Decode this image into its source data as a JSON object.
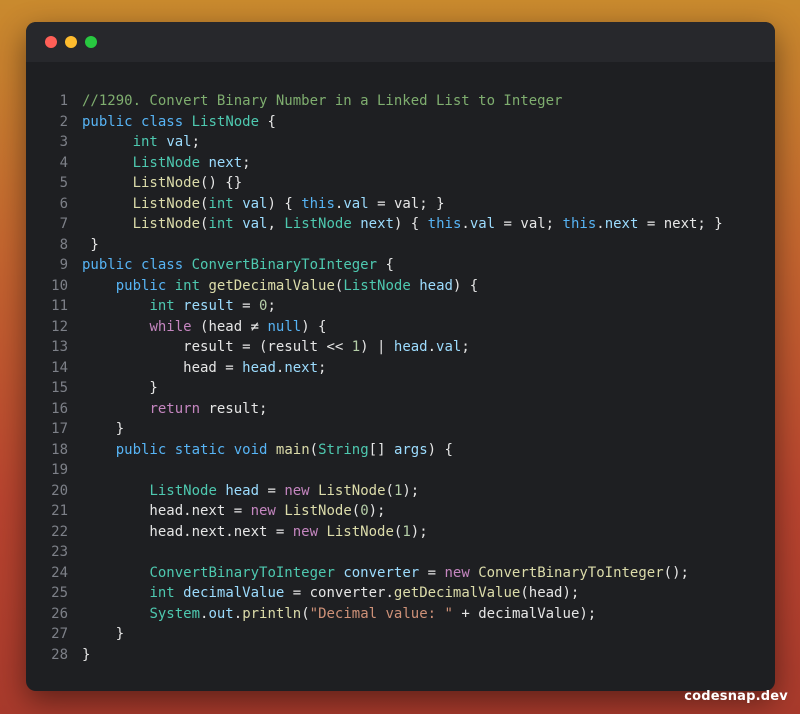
{
  "window": {
    "buttons": [
      {
        "name": "close",
        "color": "#ff5f57"
      },
      {
        "name": "minimize",
        "color": "#febc2e"
      },
      {
        "name": "maximize",
        "color": "#28c840"
      }
    ]
  },
  "code": {
    "language": "java",
    "lines": [
      {
        "n": "1",
        "tokens": [
          {
            "t": "//1290. Convert Binary Number in a Linked List to Integer",
            "c": "comment"
          }
        ]
      },
      {
        "n": "2",
        "tokens": [
          {
            "t": "public",
            "c": "kw2"
          },
          {
            "t": " ",
            "c": "plain"
          },
          {
            "t": "class",
            "c": "kw2"
          },
          {
            "t": " ",
            "c": "plain"
          },
          {
            "t": "ListNode",
            "c": "type"
          },
          {
            "t": " {",
            "c": "plain"
          }
        ]
      },
      {
        "n": "3",
        "tokens": [
          {
            "t": "      ",
            "c": "plain"
          },
          {
            "t": "int",
            "c": "type"
          },
          {
            "t": " ",
            "c": "plain"
          },
          {
            "t": "val",
            "c": "var"
          },
          {
            "t": ";",
            "c": "plain"
          }
        ]
      },
      {
        "n": "4",
        "tokens": [
          {
            "t": "      ",
            "c": "plain"
          },
          {
            "t": "ListNode",
            "c": "type"
          },
          {
            "t": " ",
            "c": "plain"
          },
          {
            "t": "next",
            "c": "var"
          },
          {
            "t": ";",
            "c": "plain"
          }
        ]
      },
      {
        "n": "5",
        "tokens": [
          {
            "t": "      ",
            "c": "plain"
          },
          {
            "t": "ListNode",
            "c": "fn"
          },
          {
            "t": "() {}",
            "c": "plain"
          }
        ]
      },
      {
        "n": "6",
        "tokens": [
          {
            "t": "      ",
            "c": "plain"
          },
          {
            "t": "ListNode",
            "c": "fn"
          },
          {
            "t": "(",
            "c": "plain"
          },
          {
            "t": "int",
            "c": "type"
          },
          {
            "t": " ",
            "c": "plain"
          },
          {
            "t": "val",
            "c": "var"
          },
          {
            "t": ") { ",
            "c": "plain"
          },
          {
            "t": "this",
            "c": "kw2"
          },
          {
            "t": ".",
            "c": "plain"
          },
          {
            "t": "val",
            "c": "var"
          },
          {
            "t": " = val; }",
            "c": "plain"
          }
        ]
      },
      {
        "n": "7",
        "tokens": [
          {
            "t": "      ",
            "c": "plain"
          },
          {
            "t": "ListNode",
            "c": "fn"
          },
          {
            "t": "(",
            "c": "plain"
          },
          {
            "t": "int",
            "c": "type"
          },
          {
            "t": " ",
            "c": "plain"
          },
          {
            "t": "val",
            "c": "var"
          },
          {
            "t": ", ",
            "c": "plain"
          },
          {
            "t": "ListNode",
            "c": "type"
          },
          {
            "t": " ",
            "c": "plain"
          },
          {
            "t": "next",
            "c": "var"
          },
          {
            "t": ") { ",
            "c": "plain"
          },
          {
            "t": "this",
            "c": "kw2"
          },
          {
            "t": ".",
            "c": "plain"
          },
          {
            "t": "val",
            "c": "var"
          },
          {
            "t": " = val; ",
            "c": "plain"
          },
          {
            "t": "this",
            "c": "kw2"
          },
          {
            "t": ".",
            "c": "plain"
          },
          {
            "t": "next",
            "c": "var"
          },
          {
            "t": " = next; }",
            "c": "plain"
          }
        ]
      },
      {
        "n": "8",
        "tokens": [
          {
            "t": " }",
            "c": "plain"
          }
        ]
      },
      {
        "n": "9",
        "tokens": [
          {
            "t": "public",
            "c": "kw2"
          },
          {
            "t": " ",
            "c": "plain"
          },
          {
            "t": "class",
            "c": "kw2"
          },
          {
            "t": " ",
            "c": "plain"
          },
          {
            "t": "ConvertBinaryToInteger",
            "c": "type"
          },
          {
            "t": " {",
            "c": "plain"
          }
        ]
      },
      {
        "n": "10",
        "tokens": [
          {
            "t": "    ",
            "c": "plain"
          },
          {
            "t": "public",
            "c": "kw2"
          },
          {
            "t": " ",
            "c": "plain"
          },
          {
            "t": "int",
            "c": "type"
          },
          {
            "t": " ",
            "c": "plain"
          },
          {
            "t": "getDecimalValue",
            "c": "fn"
          },
          {
            "t": "(",
            "c": "plain"
          },
          {
            "t": "ListNode",
            "c": "type"
          },
          {
            "t": " ",
            "c": "plain"
          },
          {
            "t": "head",
            "c": "var"
          },
          {
            "t": ") {",
            "c": "plain"
          }
        ]
      },
      {
        "n": "11",
        "tokens": [
          {
            "t": "        ",
            "c": "plain"
          },
          {
            "t": "int",
            "c": "type"
          },
          {
            "t": " ",
            "c": "plain"
          },
          {
            "t": "result",
            "c": "var"
          },
          {
            "t": " = ",
            "c": "plain"
          },
          {
            "t": "0",
            "c": "num"
          },
          {
            "t": ";",
            "c": "plain"
          }
        ]
      },
      {
        "n": "12",
        "tokens": [
          {
            "t": "        ",
            "c": "plain"
          },
          {
            "t": "while",
            "c": "kw"
          },
          {
            "t": " (head ",
            "c": "plain"
          },
          {
            "t": "≠",
            "c": "plain"
          },
          {
            "t": " ",
            "c": "plain"
          },
          {
            "t": "null",
            "c": "kw2"
          },
          {
            "t": ") {",
            "c": "plain"
          }
        ]
      },
      {
        "n": "13",
        "tokens": [
          {
            "t": "            result = (result ",
            "c": "plain"
          },
          {
            "t": "<<",
            "c": "plain"
          },
          {
            "t": " ",
            "c": "plain"
          },
          {
            "t": "1",
            "c": "num"
          },
          {
            "t": ") | ",
            "c": "plain"
          },
          {
            "t": "head",
            "c": "var"
          },
          {
            "t": ".",
            "c": "plain"
          },
          {
            "t": "val",
            "c": "var"
          },
          {
            "t": ";",
            "c": "plain"
          }
        ]
      },
      {
        "n": "14",
        "tokens": [
          {
            "t": "            head = ",
            "c": "plain"
          },
          {
            "t": "head",
            "c": "var"
          },
          {
            "t": ".",
            "c": "plain"
          },
          {
            "t": "next",
            "c": "var"
          },
          {
            "t": ";",
            "c": "plain"
          }
        ]
      },
      {
        "n": "15",
        "tokens": [
          {
            "t": "        }",
            "c": "plain"
          }
        ]
      },
      {
        "n": "16",
        "tokens": [
          {
            "t": "        ",
            "c": "plain"
          },
          {
            "t": "return",
            "c": "kw"
          },
          {
            "t": " result;",
            "c": "plain"
          }
        ]
      },
      {
        "n": "17",
        "tokens": [
          {
            "t": "    }",
            "c": "plain"
          }
        ]
      },
      {
        "n": "18",
        "tokens": [
          {
            "t": "    ",
            "c": "plain"
          },
          {
            "t": "public",
            "c": "kw2"
          },
          {
            "t": " ",
            "c": "plain"
          },
          {
            "t": "static",
            "c": "kw2"
          },
          {
            "t": " ",
            "c": "plain"
          },
          {
            "t": "void",
            "c": "kw2"
          },
          {
            "t": " ",
            "c": "plain"
          },
          {
            "t": "main",
            "c": "fn"
          },
          {
            "t": "(",
            "c": "plain"
          },
          {
            "t": "String",
            "c": "type"
          },
          {
            "t": "[] ",
            "c": "plain"
          },
          {
            "t": "args",
            "c": "var"
          },
          {
            "t": ") {",
            "c": "plain"
          }
        ]
      },
      {
        "n": "19",
        "tokens": []
      },
      {
        "n": "20",
        "tokens": [
          {
            "t": "        ",
            "c": "plain"
          },
          {
            "t": "ListNode",
            "c": "type"
          },
          {
            "t": " ",
            "c": "plain"
          },
          {
            "t": "head",
            "c": "var"
          },
          {
            "t": " = ",
            "c": "plain"
          },
          {
            "t": "new",
            "c": "kw"
          },
          {
            "t": " ",
            "c": "plain"
          },
          {
            "t": "ListNode",
            "c": "fn"
          },
          {
            "t": "(",
            "c": "plain"
          },
          {
            "t": "1",
            "c": "num"
          },
          {
            "t": ");",
            "c": "plain"
          }
        ]
      },
      {
        "n": "21",
        "tokens": [
          {
            "t": "        head.next = ",
            "c": "plain"
          },
          {
            "t": "new",
            "c": "kw"
          },
          {
            "t": " ",
            "c": "plain"
          },
          {
            "t": "ListNode",
            "c": "fn"
          },
          {
            "t": "(",
            "c": "plain"
          },
          {
            "t": "0",
            "c": "num"
          },
          {
            "t": ");",
            "c": "plain"
          }
        ]
      },
      {
        "n": "22",
        "tokens": [
          {
            "t": "        head.next.next = ",
            "c": "plain"
          },
          {
            "t": "new",
            "c": "kw"
          },
          {
            "t": " ",
            "c": "plain"
          },
          {
            "t": "ListNode",
            "c": "fn"
          },
          {
            "t": "(",
            "c": "plain"
          },
          {
            "t": "1",
            "c": "num"
          },
          {
            "t": ");",
            "c": "plain"
          }
        ]
      },
      {
        "n": "23",
        "tokens": []
      },
      {
        "n": "24",
        "tokens": [
          {
            "t": "        ",
            "c": "plain"
          },
          {
            "t": "ConvertBinaryToInteger",
            "c": "type"
          },
          {
            "t": " ",
            "c": "plain"
          },
          {
            "t": "converter",
            "c": "var"
          },
          {
            "t": " = ",
            "c": "plain"
          },
          {
            "t": "new",
            "c": "kw"
          },
          {
            "t": " ",
            "c": "plain"
          },
          {
            "t": "ConvertBinaryToInteger",
            "c": "fn"
          },
          {
            "t": "();",
            "c": "plain"
          }
        ]
      },
      {
        "n": "25",
        "tokens": [
          {
            "t": "        ",
            "c": "plain"
          },
          {
            "t": "int",
            "c": "type"
          },
          {
            "t": " ",
            "c": "plain"
          },
          {
            "t": "decimalValue",
            "c": "var"
          },
          {
            "t": " = converter.",
            "c": "plain"
          },
          {
            "t": "getDecimalValue",
            "c": "fn"
          },
          {
            "t": "(head);",
            "c": "plain"
          }
        ]
      },
      {
        "n": "26",
        "tokens": [
          {
            "t": "        ",
            "c": "plain"
          },
          {
            "t": "System",
            "c": "type"
          },
          {
            "t": ".",
            "c": "plain"
          },
          {
            "t": "out",
            "c": "var"
          },
          {
            "t": ".",
            "c": "plain"
          },
          {
            "t": "println",
            "c": "fn"
          },
          {
            "t": "(",
            "c": "plain"
          },
          {
            "t": "\"Decimal value: \"",
            "c": "str"
          },
          {
            "t": " + decimalValue);",
            "c": "plain"
          }
        ]
      },
      {
        "n": "27",
        "tokens": [
          {
            "t": "    }",
            "c": "plain"
          }
        ]
      },
      {
        "n": "28",
        "tokens": [
          {
            "t": "}",
            "c": "plain"
          }
        ]
      }
    ]
  },
  "footer": {
    "brand": "codesnap.dev"
  }
}
